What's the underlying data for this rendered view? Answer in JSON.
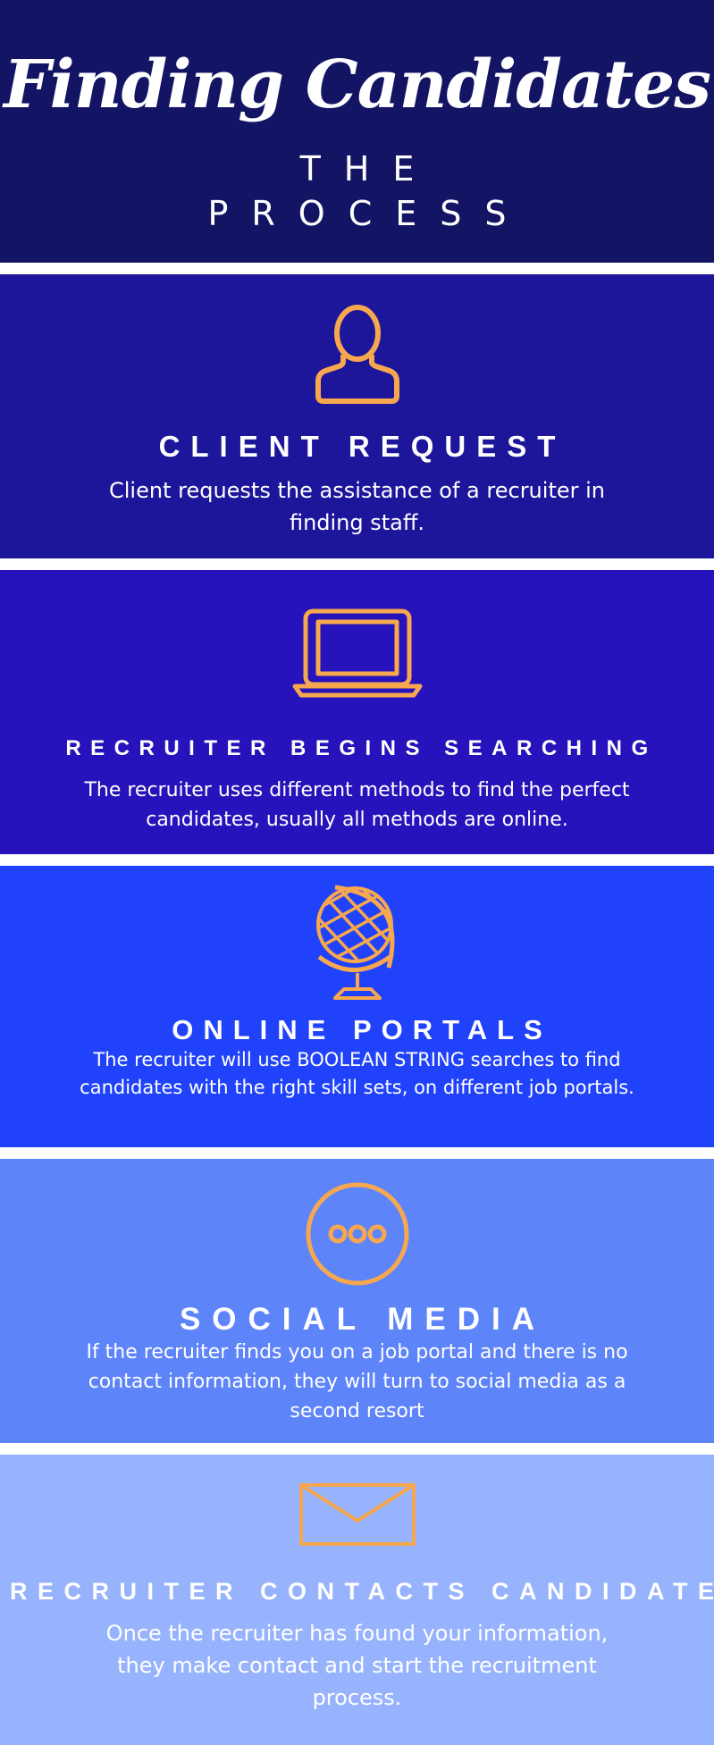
{
  "header": {
    "title": "Finding Candidates",
    "subtitle_line1": "THE",
    "subtitle_line2": "PROCESS"
  },
  "steps": [
    {
      "icon": "person-icon",
      "title": "CLIENT REQUEST",
      "description": "Client requests the assistance of a recruiter in finding staff."
    },
    {
      "icon": "laptop-icon",
      "title": "RECRUITER BEGINS SEARCHING",
      "description": "The recruiter uses different methods to find the perfect candidates, usually all methods are online."
    },
    {
      "icon": "globe-icon",
      "title": "ONLINE PORTALS",
      "description": "The recruiter will use BOOLEAN STRING searches to find candidates with the right skill sets, on different job portals."
    },
    {
      "icon": "chat-bubble-icon",
      "title": "SOCIAL MEDIA",
      "description": "If the recruiter finds you on a job portal and there is no contact information, they will turn to social media as a second resort"
    },
    {
      "icon": "envelope-icon",
      "title": "RECRUITER CONTACTS CANDIDATE",
      "description": "Once the recruiter has found your information, they make contact and start the recruitment process."
    }
  ],
  "colors": {
    "header_bg": "#131463",
    "step1_bg": "#1d169b",
    "step2_bg": "#2613bb",
    "step3_bg": "#2142fb",
    "step4_bg": "#5e84fa",
    "step5_bg": "#97b3fe",
    "icon_accent": "#f7a84e"
  }
}
